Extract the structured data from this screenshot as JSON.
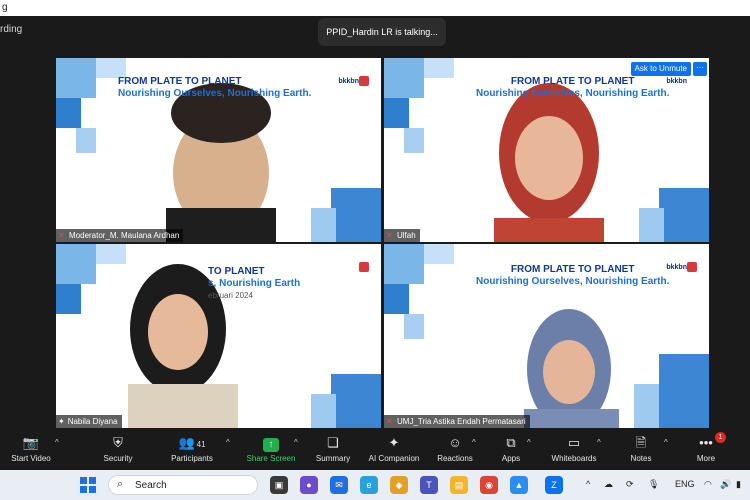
{
  "window": {
    "title_fragment": "g",
    "recording_fragment": "rding"
  },
  "talking_indicator": "PPID_Hardin LR is talking...",
  "tiles": [
    {
      "name": "Moderator_M. Maulana Ardhan",
      "banner_line1": "FROM PLATE TO PLANET",
      "banner_line2": "Nourishing Ourselves, Nourishing Earth.",
      "brand": "bkkbn"
    },
    {
      "name": "Ulfah",
      "banner_line1": "FROM PLATE TO PLANET",
      "banner_line2": "Nourishing Ourselves, Nourishing Earth.",
      "brand": "bkkbn"
    },
    {
      "name": "Nabila Diyana",
      "banner_line1": "TO PLANET",
      "banner_line2": "s, Nourishing Earth",
      "banner_line3": "ebruari 2024"
    },
    {
      "name": "UMJ_Tria Astika Endah Permatasari",
      "banner_line1": "FROM PLATE TO PLANET",
      "banner_line2": "Nourishing Ourselves, Nourishing Earth.",
      "brand": "bkkbn"
    }
  ],
  "ask_to_unmute": "Ask to Unmute",
  "more_dots": "···",
  "toolbar": {
    "start_video": "Start Video",
    "security": "Security",
    "participants": "Participants",
    "participants_count": "41",
    "share_screen": "Share Screen",
    "summary": "Summary",
    "ai_companion": "AI Companion",
    "reactions": "Reactions",
    "apps": "Apps",
    "whiteboards": "Whiteboards",
    "notes": "Notes",
    "more": "More",
    "more_badge": "1"
  },
  "taskbar": {
    "search_placeholder": "Search",
    "language": "ENG"
  },
  "colors": {
    "accent": "#0e72ed",
    "share_green": "#20b04b",
    "mute_red": "#e24a4a"
  }
}
